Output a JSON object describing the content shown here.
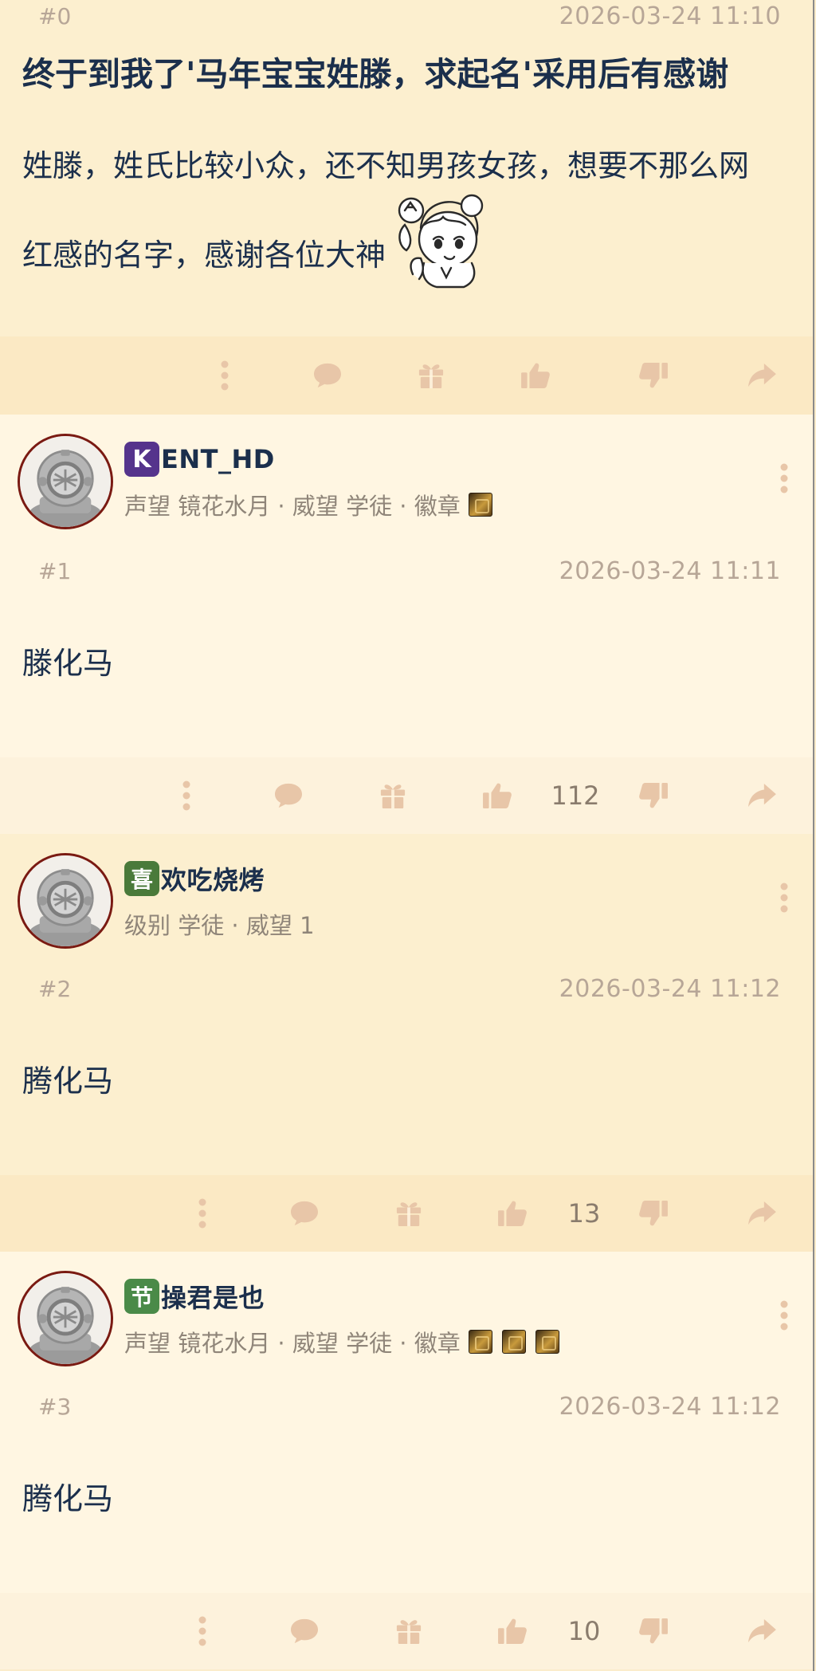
{
  "post0": {
    "floor": "#0",
    "time": "2026-03-24 11:10",
    "title": "终于到我了'马年宝宝姓滕，求起名'采用后有感谢",
    "body_line1": "姓滕，姓氏比较小众，还不知男孩女孩，想要不那么网",
    "body_line2": "红感的名字，感谢各位大神"
  },
  "replies": [
    {
      "user": {
        "badge_char": "K",
        "badge_color": "#55348c",
        "name": "ENT_HD",
        "info": "声望 镜花水月 · 威望 学徒 · 徽章",
        "medal_count": 1
      },
      "floor": "#1",
      "time": "2026-03-24 11:11",
      "body": "滕化马",
      "likes": "112"
    },
    {
      "user": {
        "badge_char": "喜",
        "badge_color": "#4a7a3a",
        "name": "欢吃烧烤",
        "info": "级别 学徒 · 威望 1",
        "medal_count": 0
      },
      "floor": "#2",
      "time": "2026-03-24 11:12",
      "body": "腾化马",
      "likes": "13"
    },
    {
      "user": {
        "badge_char": "节",
        "badge_color": "#4a8a48",
        "name": "操君是也",
        "info": "声望 镜花水月 · 威望 学徒 · 徽章",
        "medal_count": 3
      },
      "floor": "#3",
      "time": "2026-03-24 11:12",
      "body": "腾化马",
      "likes": "10"
    }
  ],
  "icons": {
    "more": "more-vertical-icon",
    "comment": "comment-icon",
    "gift": "gift-icon",
    "like": "thumbs-up-icon",
    "dislike": "thumbs-down-icon",
    "share": "share-icon"
  },
  "colors": {
    "icon": "#e8c6a8",
    "text": "#1b2f4c",
    "meta": "#b7a697",
    "avatar_border": "#7a1a12"
  }
}
